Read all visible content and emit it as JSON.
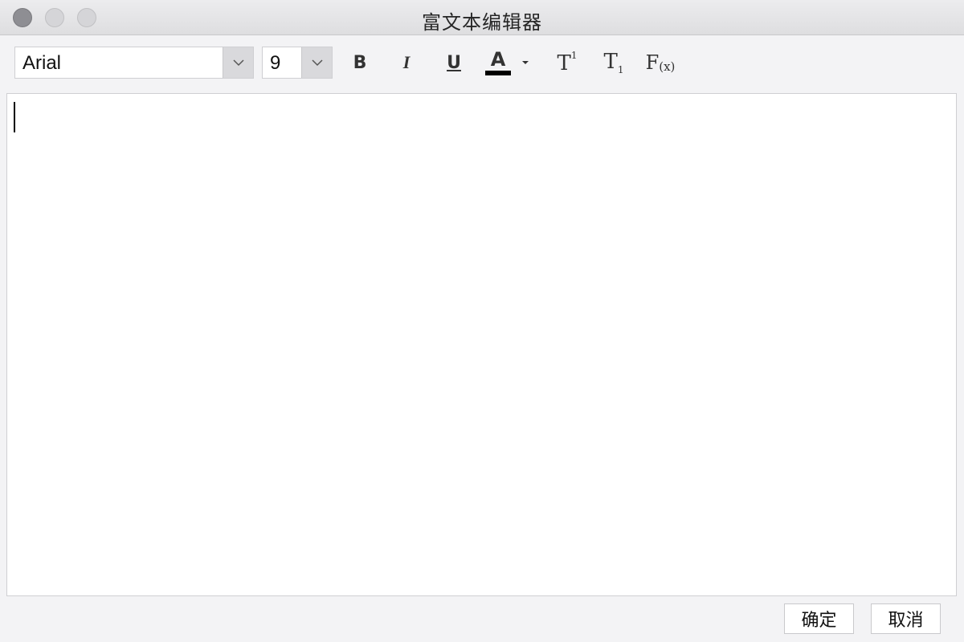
{
  "window": {
    "title": "富文本编辑器"
  },
  "toolbar": {
    "font_family": "Arial",
    "font_size": "9",
    "bold_label": "B",
    "italic_label": "I",
    "underline_label": "U",
    "font_color_label": "A",
    "font_color_value": "#000000",
    "superscript_base": "T",
    "superscript_mark": "1",
    "subscript_base": "T",
    "subscript_mark": "1",
    "formula_base": "F",
    "formula_mark": "(x)"
  },
  "editor": {
    "content": ""
  },
  "footer": {
    "ok_label": "确定",
    "cancel_label": "取消"
  },
  "icons": {
    "close": "close-icon",
    "minimize": "minimize-icon",
    "maximize": "maximize-icon",
    "dropdown": "chevron-down-icon",
    "color_dropdown": "caret-down-icon"
  }
}
